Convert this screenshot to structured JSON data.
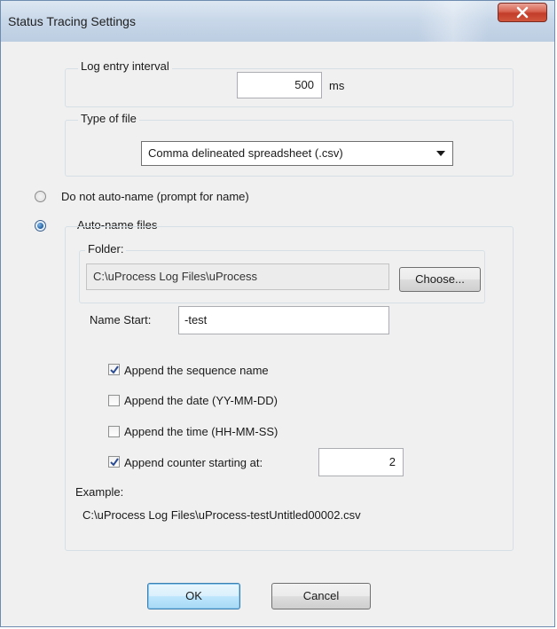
{
  "window": {
    "title": "Status Tracing Settings"
  },
  "log_interval": {
    "label": "Log entry interval",
    "value": "500",
    "unit": "ms"
  },
  "file_type": {
    "label": "Type of file",
    "selected": "Comma delineated spreadsheet (.csv)"
  },
  "naming": {
    "no_autoname_label": "Do not auto-name (prompt for name)",
    "autoname_label": "Auto-name files",
    "selected": "autoname",
    "folder_label": "Folder:",
    "folder_path": "C:\\uProcess Log Files\\uProcess",
    "choose_label": "Choose...",
    "name_start_label": "Name Start:",
    "name_start_value": "-test",
    "options": [
      {
        "label": "Append the sequence name",
        "checked": true
      },
      {
        "label": "Append the date (YY-MM-DD)",
        "checked": false
      },
      {
        "label": "Append the time (HH-MM-SS)",
        "checked": false
      },
      {
        "label": "Append counter starting at:",
        "checked": true
      }
    ],
    "counter_start": "2",
    "example_label": "Example:",
    "example_value": "C:\\uProcess Log Files\\uProcess-testUntitled00002.csv"
  },
  "buttons": {
    "ok": "OK",
    "cancel": "Cancel"
  }
}
